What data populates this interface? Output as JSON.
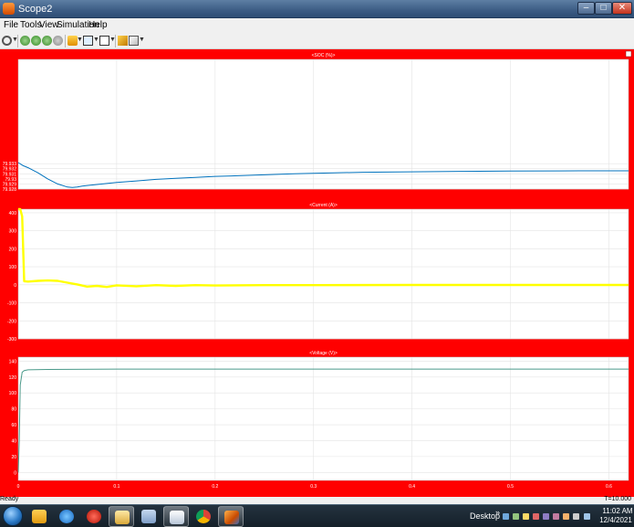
{
  "window": {
    "title": "Scope2",
    "min": "–",
    "max": "□",
    "close": "✕"
  },
  "menu": [
    {
      "label": "File"
    },
    {
      "label": "Tools"
    },
    {
      "label": "View"
    },
    {
      "label": "Simulation"
    },
    {
      "label": "Help"
    }
  ],
  "toolbar": {
    "icons": [
      "settings-icon",
      "step-back-icon",
      "run-icon",
      "step-forward-icon",
      "stop-icon",
      "highlight-icon",
      "zoom-icon",
      "fit-to-view-icon",
      "signal-triggers-icon",
      "style-icon"
    ]
  },
  "colors": {
    "scope_background": "#ff0000",
    "plot_background": "#ffffff",
    "soc_line": "#0072bd",
    "current_line": "#ffff00",
    "voltage_line": "#4a9a8a"
  },
  "chart_data": [
    {
      "type": "line",
      "title": "<SOC (%)>",
      "xlim": [
        0,
        0.62
      ],
      "ylim": [
        79.928,
        79.9535
      ],
      "yticks": [
        "79.933",
        "79.932",
        "79.931",
        "79.93",
        "79.929",
        "79.928"
      ],
      "ytick_values": [
        79.933,
        79.932,
        79.931,
        79.93,
        79.929,
        79.928
      ],
      "series": [
        {
          "x": [
            0,
            0.005,
            0.01,
            0.02,
            0.03,
            0.04,
            0.05,
            0.055,
            0.06,
            0.065,
            0.07,
            0.08,
            0.09,
            0.1,
            0.12,
            0.14,
            0.16,
            0.18,
            0.2,
            0.22,
            0.25,
            0.28,
            0.3,
            0.35,
            0.4,
            0.45,
            0.5,
            0.55,
            0.6,
            0.62
          ],
          "y": [
            79.9332,
            79.9326,
            79.9322,
            79.9312,
            79.93,
            79.929,
            79.9284,
            79.9283,
            79.9284,
            79.9286,
            79.9287,
            79.9289,
            79.9291,
            79.9293,
            79.9296,
            79.9299,
            79.9301,
            79.9303,
            79.9305,
            79.9306,
            79.9308,
            79.931,
            79.9311,
            79.9313,
            79.9314,
            79.93148,
            79.93153,
            79.93157,
            79.9316,
            79.9316
          ]
        }
      ]
    },
    {
      "type": "line",
      "title": "<Current (A)>",
      "xlim": [
        0,
        0.62
      ],
      "ylim": [
        -300,
        420
      ],
      "yticks": [
        "400",
        "300",
        "200",
        "100",
        "0",
        "-100",
        "-200",
        "-300"
      ],
      "ytick_values": [
        400,
        300,
        200,
        100,
        0,
        -100,
        -200,
        -300
      ],
      "series": [
        {
          "x": [
            0,
            0.002,
            0.004,
            0.006,
            0.01,
            0.02,
            0.03,
            0.04,
            0.05,
            0.06,
            0.07,
            0.08,
            0.09,
            0.1,
            0.12,
            0.14,
            0.16,
            0.18,
            0.2,
            0.25,
            0.3,
            0.4,
            0.5,
            0.62
          ],
          "y": [
            420,
            420,
            380,
            20,
            18,
            22,
            24,
            22,
            12,
            2,
            -10,
            -6,
            -12,
            -3,
            -8,
            -2,
            -6,
            -2,
            -4,
            -2,
            -2,
            -1,
            -1,
            -1
          ]
        }
      ]
    },
    {
      "type": "line",
      "title": "<Voltage (V)>",
      "xlim": [
        0,
        0.62
      ],
      "ylim": [
        -10,
        145
      ],
      "yticks": [
        "140",
        "120",
        "100",
        "80",
        "60",
        "40",
        "20",
        "0"
      ],
      "ytick_values": [
        140,
        120,
        100,
        80,
        60,
        40,
        20,
        0
      ],
      "xticks": [
        "0",
        "0.1",
        "0.2",
        "0.3",
        "0.4",
        "0.5",
        "0.6"
      ],
      "xtick_values": [
        0,
        0.1,
        0.2,
        0.3,
        0.4,
        0.5,
        0.6
      ],
      "series": [
        {
          "x": [
            0,
            0.001,
            0.002,
            0.004,
            0.006,
            0.01,
            0.03,
            0.1,
            0.3,
            0.62
          ],
          "y": [
            0,
            40,
            110,
            126,
            128,
            129,
            129.5,
            130,
            130,
            130
          ]
        }
      ]
    }
  ],
  "status": {
    "text": "Ready",
    "time_offset": "T=10.000"
  },
  "taskbar": {
    "apps": [
      "explorer-icon",
      "media-player-icon",
      "ie-icon",
      "solidworks-icon",
      "file-manager-icon",
      "calculator-icon",
      "paint-icon",
      "chrome-icon",
      "matlab-icon"
    ],
    "desktop": "Desktop",
    "chevron": "»",
    "time": "11:02 AM",
    "date": "12/4/2021"
  }
}
